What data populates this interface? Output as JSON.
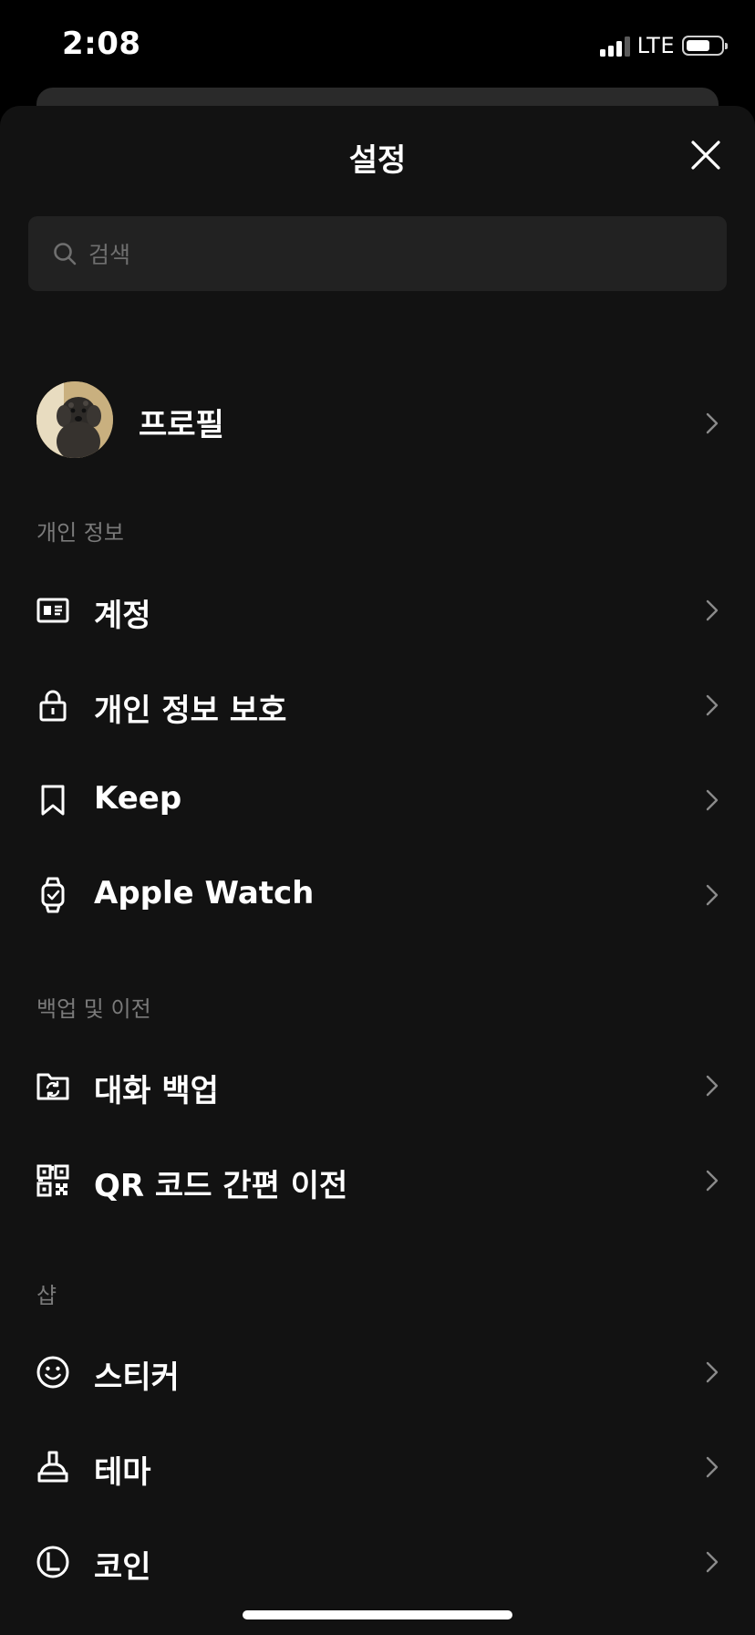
{
  "status_bar": {
    "time": "2:08",
    "network": "LTE",
    "signal_bars": 3,
    "signal_max": 4,
    "battery_level": 0.7
  },
  "sheet": {
    "title": "설정",
    "close_icon": "close-icon"
  },
  "search": {
    "placeholder": "검색",
    "value": ""
  },
  "profile": {
    "label": "프로필"
  },
  "sections": {
    "personal": {
      "header": "개인 정보",
      "items": [
        {
          "label": "계정",
          "icon": "id-card-icon"
        },
        {
          "label": "개인 정보 보호",
          "icon": "lock-icon"
        },
        {
          "label": "Keep",
          "icon": "bookmark-icon"
        },
        {
          "label": "Apple Watch",
          "icon": "watch-icon"
        }
      ]
    },
    "backup": {
      "header": "백업 및 이전",
      "items": [
        {
          "label": "대화 백업",
          "icon": "folder-sync-icon"
        },
        {
          "label": "QR 코드 간편 이전",
          "icon": "qr-code-icon"
        }
      ]
    },
    "shop": {
      "header": "샵",
      "items": [
        {
          "label": "스티커",
          "icon": "smiley-icon"
        },
        {
          "label": "테마",
          "icon": "brush-icon"
        },
        {
          "label": "코인",
          "icon": "coin-icon"
        }
      ]
    }
  },
  "colors": {
    "background": "#000000",
    "sheet": "#121212",
    "search_bg": "#222222",
    "section_header": "#7a7a7a",
    "chevron": "#8a8a8a",
    "text": "#ffffff"
  }
}
